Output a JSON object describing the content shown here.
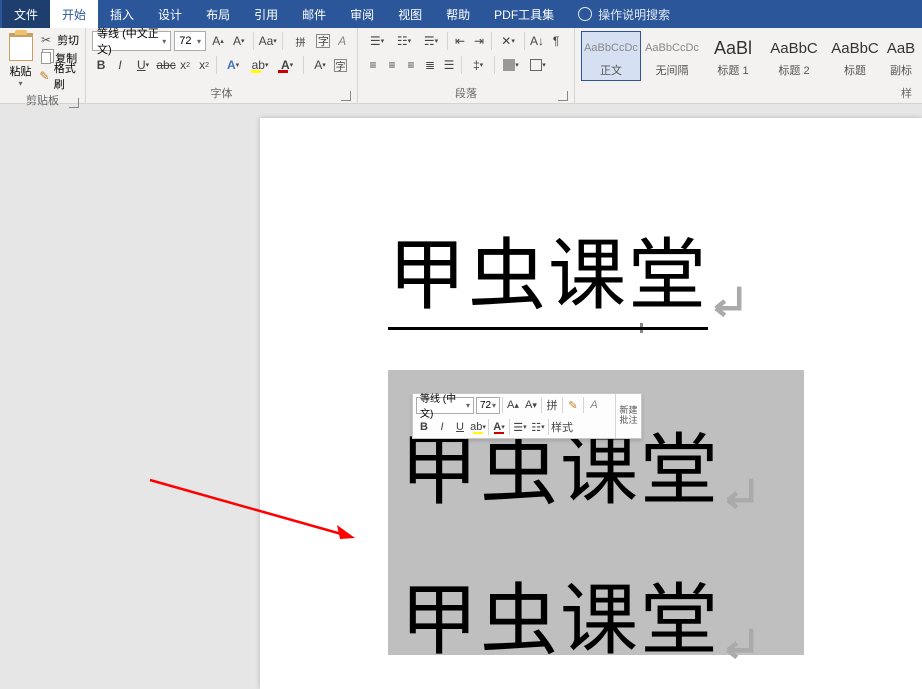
{
  "menu": {
    "file": "文件",
    "home": "开始",
    "insert": "插入",
    "design": "设计",
    "layout": "布局",
    "refs": "引用",
    "mail": "邮件",
    "review": "审阅",
    "view": "视图",
    "help": "帮助",
    "pdf": "PDF工具集",
    "search": "操作说明搜索"
  },
  "ribbon": {
    "clipboard": {
      "label": "剪贴板",
      "paste": "粘贴",
      "cut": "剪切",
      "copy": "复制",
      "format_painter": "格式刷"
    },
    "font": {
      "label": "字体",
      "name": "等线 (中文正文)",
      "size": "72"
    },
    "paragraph": {
      "label": "段落"
    },
    "styles": {
      "label": "样",
      "preview": "AaBbCcDc",
      "preview_big": "AaBl",
      "preview_med": "AaBbC",
      "preview_ab": "AaB",
      "normal": "正文",
      "nospace": "无间隔",
      "h1": "标题 1",
      "h2": "标题 2",
      "title": "标题",
      "subtitle": "副标"
    }
  },
  "mini": {
    "font_name": "等线 (中文)",
    "font_size": "72",
    "styles": "样式",
    "new_comment_l1": "新建",
    "new_comment_l2": "批注"
  },
  "doc": {
    "line1": "甲虫课堂",
    "line2": "甲虫课堂",
    "line3": "甲虫课堂"
  }
}
